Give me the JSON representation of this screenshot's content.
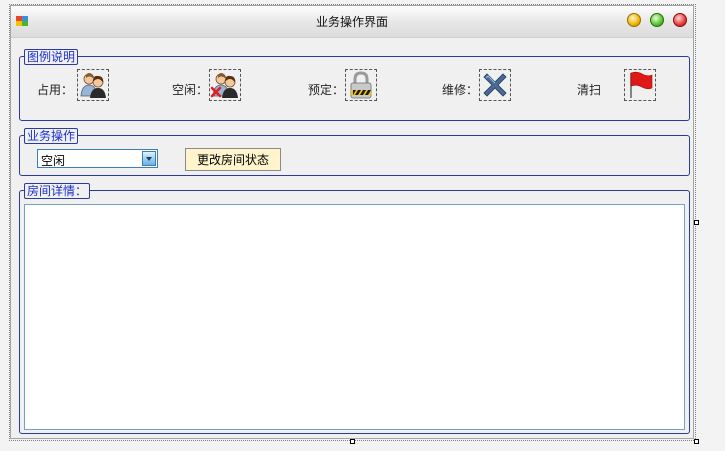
{
  "window": {
    "title": "业务操作界面"
  },
  "legend_group": {
    "title": "图例说明",
    "items": [
      {
        "label": "占用：",
        "icon": "users-icon"
      },
      {
        "label": "空闲：",
        "icon": "users-remove-icon"
      },
      {
        "label": "预定：",
        "icon": "lock-icon"
      },
      {
        "label": "维修：",
        "icon": "cross-icon"
      },
      {
        "label": "清扫",
        "icon": "red-flag-icon"
      }
    ]
  },
  "operation_group": {
    "title": "业务操作",
    "select_value": "空闲",
    "change_button": "更改房间状态"
  },
  "details_group": {
    "title": "房间详情：",
    "content": ""
  },
  "colors": {
    "group_border": "#2b3a9b",
    "group_title": "#1a2fd0",
    "button_bg": "#fff4cc"
  }
}
